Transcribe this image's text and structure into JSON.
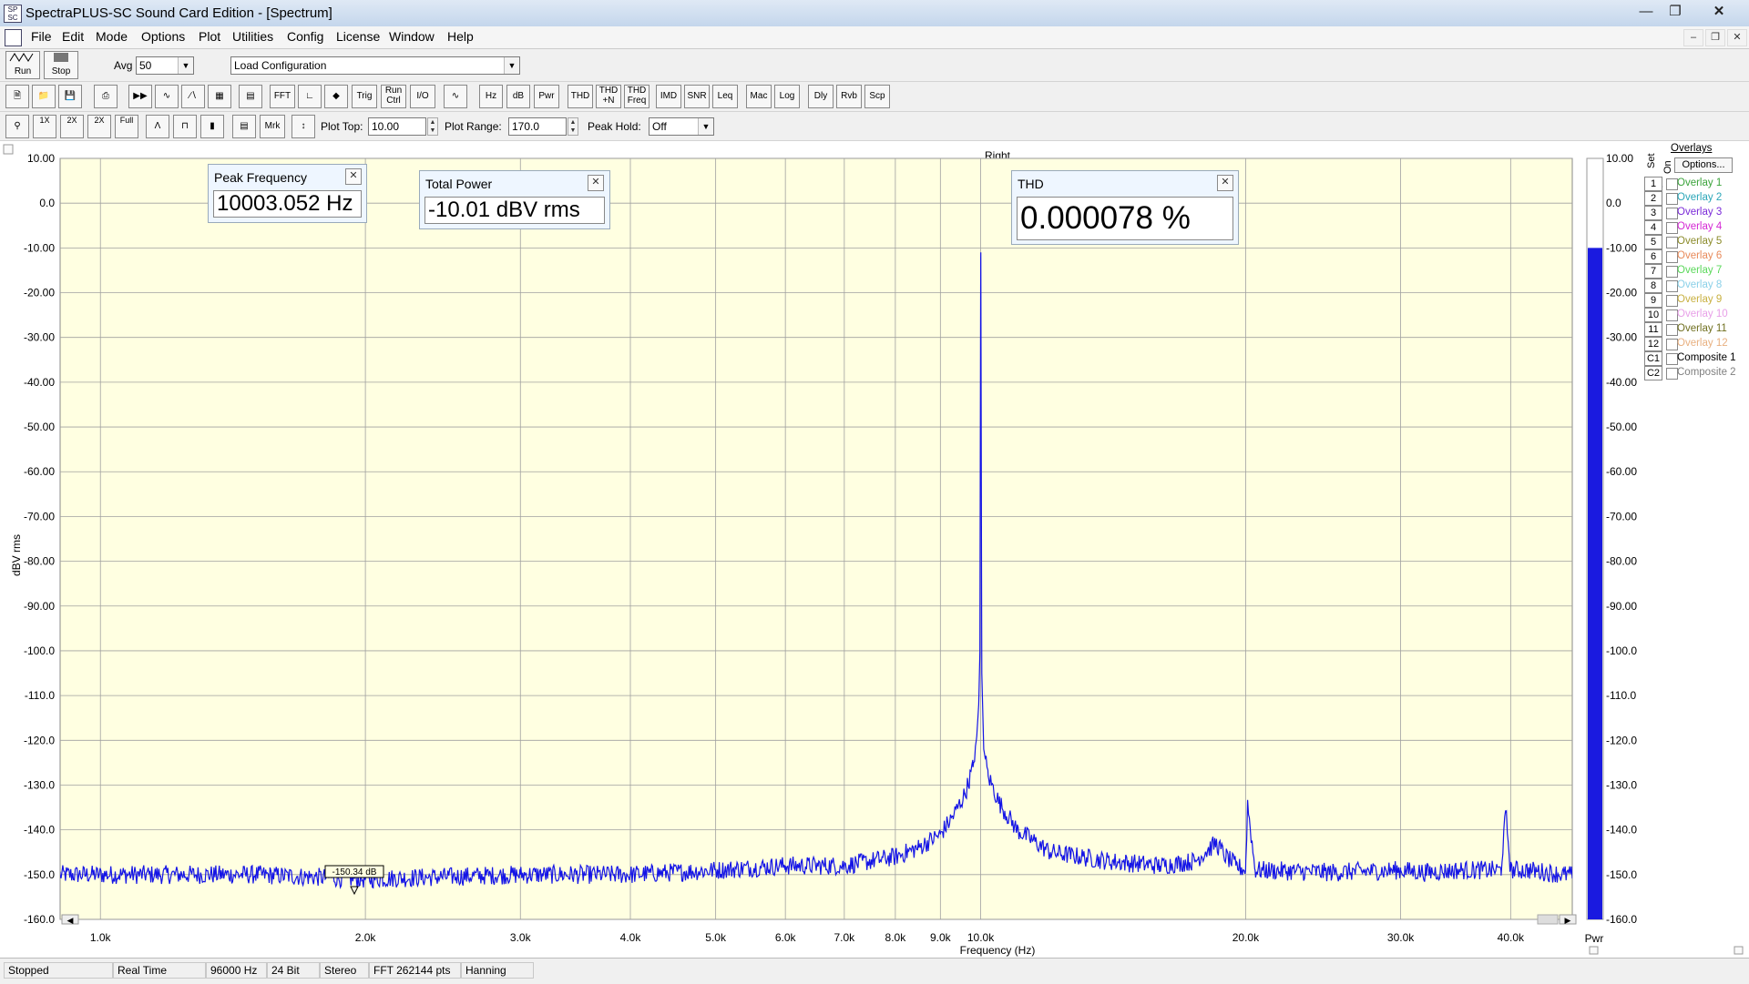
{
  "window": {
    "title": "SpectraPLUS-SC Sound Card Edition - [Spectrum]",
    "app_icon_text": "SP SC"
  },
  "menu": [
    "File",
    "Edit",
    "Mode",
    "Options",
    "Plot",
    "Utilities",
    "Config",
    "License",
    "Window",
    "Help"
  ],
  "toolbar1": {
    "run_label": "Run",
    "stop_label": "Stop",
    "avg_label": "Avg",
    "avg_value": "50",
    "config_value": "Load Configuration"
  },
  "toolbar2": [
    "FFT",
    "Trig",
    "Run Ctrl",
    "I/O",
    "Hz",
    "dB",
    "Pwr",
    "THD",
    "THD +N",
    "THD Freq",
    "IMD",
    "SNR",
    "Leq",
    "Mac",
    "Log",
    "Dly",
    "Rvb",
    "Scp"
  ],
  "toolbar3": {
    "buttons": [
      "1X",
      "2X",
      "2X",
      "Full",
      "Mrk"
    ],
    "plot_top_label": "Plot Top:",
    "plot_top_value": "10.00",
    "plot_range_label": "Plot Range:",
    "plot_range_value": "170.0",
    "peak_hold_label": "Peak Hold:",
    "peak_hold_value": "Off"
  },
  "plot": {
    "channel_title": "Right",
    "watermark": "S+",
    "marker_readout": "-150.34 dB",
    "pwr_label": "Pwr",
    "pwr_level_db": -10,
    "trace_color": "#1414e6",
    "bg_color": "#ffffe1"
  },
  "meters": {
    "peak_frequency": {
      "title": "Peak Frequency",
      "value": "10003.052 Hz"
    },
    "total_power": {
      "title": "Total Power",
      "value": "-10.01 dBV rms"
    },
    "thd": {
      "title": "THD",
      "value": "0.000078 %"
    }
  },
  "overlays": {
    "title": "Overlays",
    "set_label": "Set",
    "on_label": "On",
    "options_label": "Options...",
    "items": [
      {
        "num": "1",
        "name": "Overlay 1",
        "color": "#3aa33a"
      },
      {
        "num": "2",
        "name": "Overlay 2",
        "color": "#2aa6b8"
      },
      {
        "num": "3",
        "name": "Overlay 3",
        "color": "#7a2ad8"
      },
      {
        "num": "4",
        "name": "Overlay 4",
        "color": "#d428d4"
      },
      {
        "num": "5",
        "name": "Overlay 5",
        "color": "#8b8b2a"
      },
      {
        "num": "6",
        "name": "Overlay 6",
        "color": "#e88a5a"
      },
      {
        "num": "7",
        "name": "Overlay 7",
        "color": "#5ad85a"
      },
      {
        "num": "8",
        "name": "Overlay 8",
        "color": "#8ad0e8"
      },
      {
        "num": "9",
        "name": "Overlay 9",
        "color": "#c8b040"
      },
      {
        "num": "10",
        "name": "Overlay 10",
        "color": "#e8a0e8"
      },
      {
        "num": "11",
        "name": "Overlay 11",
        "color": "#707020"
      },
      {
        "num": "12",
        "name": "Overlay 12",
        "color": "#e8b080"
      },
      {
        "num": "C1",
        "name": "Composite 1",
        "color": "#000000"
      },
      {
        "num": "C2",
        "name": "Composite 2",
        "color": "#808080"
      }
    ]
  },
  "status": [
    "Stopped",
    "Real Time",
    "96000 Hz",
    "24 Bit",
    "Stereo",
    "FFT 262144 pts",
    "Hanning"
  ],
  "chart_data": {
    "type": "line",
    "xlabel": "Frequency (Hz)",
    "ylabel": "dBV rms",
    "x_scale": "log",
    "xlim": [
      900,
      47000
    ],
    "ylim": [
      -160,
      10
    ],
    "y_ticks": [
      10,
      0,
      -10,
      -20,
      -30,
      -40,
      -50,
      -60,
      -70,
      -80,
      -90,
      -100,
      -110,
      -120,
      -130,
      -140,
      -150,
      -160
    ],
    "y_tick_labels": [
      "10.00",
      "0.0",
      "-10.00",
      "-20.00",
      "-30.00",
      "-40.00",
      "-50.00",
      "-60.00",
      "-70.00",
      "-80.00",
      "-90.00",
      "-100.0",
      "-110.0",
      "-120.0",
      "-130.0",
      "-140.0",
      "-150.0",
      "-160.0"
    ],
    "x_ticks": [
      1000,
      2000,
      3000,
      4000,
      5000,
      6000,
      7000,
      8000,
      9000,
      10000,
      20000,
      30000,
      40000
    ],
    "x_tick_labels": [
      "1.0k",
      "2.0k",
      "3.0k",
      "4.0k",
      "5.0k",
      "6.0k",
      "7.0k",
      "8.0k",
      "9.0k",
      "10.0k",
      "20.0k",
      "30.0k",
      "40.0k"
    ],
    "grid": true,
    "series": [
      {
        "x": [
          900,
          1500,
          2000,
          3000,
          4000,
          5000,
          6000,
          7000,
          8000,
          8500,
          9000,
          9300,
          9600,
          9800,
          9900,
          9950,
          9980,
          10003,
          10030,
          10080,
          10200,
          10500,
          11000,
          12000,
          14000,
          16000,
          17500,
          18000,
          18500,
          19000,
          19500,
          20000,
          20100,
          20500,
          25000,
          30000,
          32000,
          35000,
          39000,
          39500,
          40000,
          42000,
          46000
        ],
        "y": [
          -150,
          -150,
          -151,
          -150,
          -150,
          -149,
          -148,
          -148,
          -146,
          -144,
          -141,
          -137,
          -132,
          -126,
          -119,
          -112,
          -100,
          -11,
          -105,
          -122,
          -128,
          -134,
          -140,
          -145,
          -147,
          -148,
          -147,
          -145,
          -143,
          -146,
          -148,
          -149,
          -134,
          -149,
          -149.5,
          -149,
          -149.5,
          -149,
          -149,
          -136,
          -149,
          -149,
          -150
        ]
      }
    ]
  }
}
